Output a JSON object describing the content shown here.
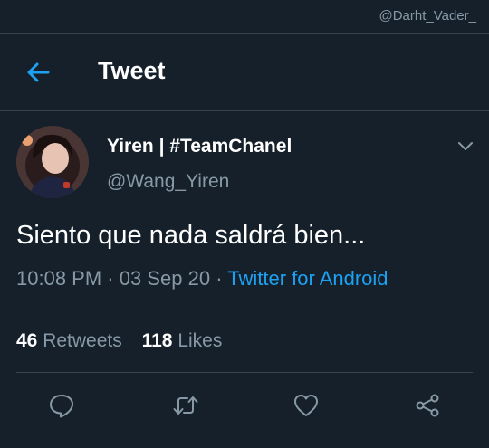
{
  "watermark": "@Darht_Vader_",
  "header": {
    "title": "Tweet"
  },
  "tweet": {
    "display_name": "Yiren | #TeamChanel",
    "handle": "@Wang_Yiren",
    "text": "Siento que nada saldrá bien...",
    "time": "10:08 PM",
    "date": "03 Sep 20",
    "source": "Twitter for Android"
  },
  "stats": {
    "retweets_count": "46",
    "retweets_label": "Retweets",
    "likes_count": "118",
    "likes_label": "Likes"
  },
  "colors": {
    "background": "#15202b",
    "accent": "#1da1f2",
    "muted": "#8899a6",
    "divider": "#38444d"
  },
  "icons": {
    "back": "arrow-left-icon",
    "caret": "chevron-down-icon",
    "reply": "reply-icon",
    "retweet": "retweet-icon",
    "like": "heart-icon",
    "share": "share-icon"
  }
}
